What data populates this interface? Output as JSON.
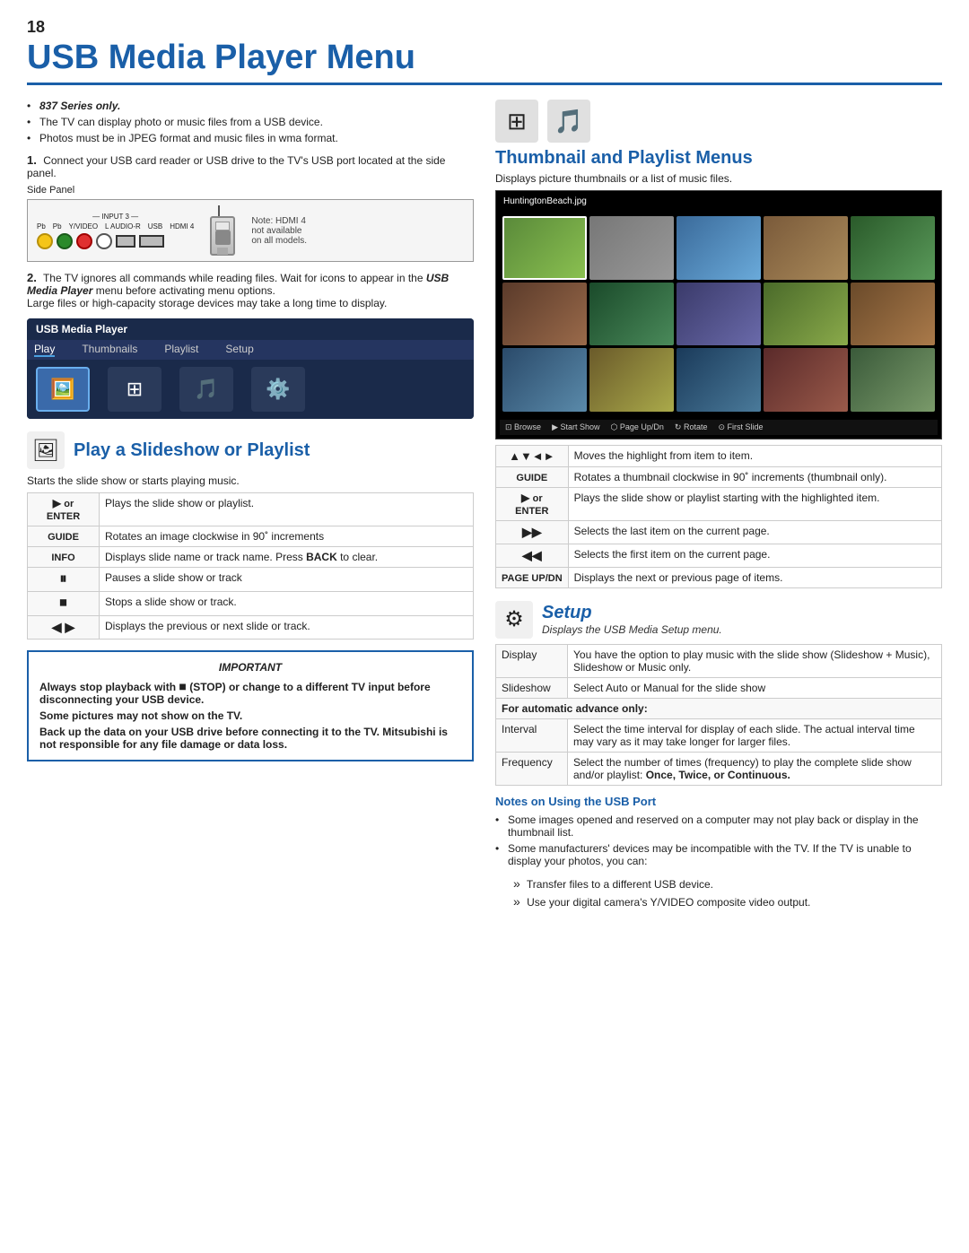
{
  "page": {
    "number": "18",
    "title": "USB Media Player Menu"
  },
  "left_col": {
    "series_note": "837 Series only.",
    "bullet1": "The TV can display photo or music files from a USB device.",
    "bullet2": "Photos must be in JPEG format and music files in wma format.",
    "step1_text": "Connect your USB card reader or USB drive to the TV's USB port located at the side panel.",
    "side_panel_label": "Side Panel",
    "note_hdmi": "Note: HDMI 4",
    "note_hdmi2": "not available",
    "note_hdmi3": "on all models.",
    "step2_text": "The TV ignores all commands while reading files. Wait for icons to appear in the",
    "step2_bold": "USB Media Player",
    "step2_text2": "menu before activating menu options.",
    "step2_text3": "Large files or high-capacity storage devices may take a long time to display.",
    "usb_player": {
      "title": "USB Media Player",
      "tabs": [
        "Play",
        "Thumbnails",
        "Playlist",
        "Setup"
      ]
    }
  },
  "slideshow_section": {
    "title": "Play a Slideshow or Playlist",
    "subtitle": "Starts the slide show or starts playing music.",
    "controls": [
      {
        "key": "▶ or ENTER",
        "desc": "Plays the slide show or playlist."
      },
      {
        "key": "GUIDE",
        "desc": "Rotates an image clockwise in 90˚ increments"
      },
      {
        "key": "INFO",
        "desc": "Displays slide name or track name. Press BACK to clear."
      },
      {
        "key": "⏸",
        "desc": "Pauses a slide show or track"
      },
      {
        "key": "⏹",
        "desc": "Stops a slide show or track."
      },
      {
        "key": "◀ ▶",
        "desc": "Displays the previous or next slide or track."
      }
    ],
    "important_title": "IMPORTANT",
    "important_lines": [
      "Always stop playback with ■ (STOP) or change to a different TV input before disconnecting your USB device.",
      "Some pictures may not show on the TV.",
      "Back up the data on your USB drive before connecting it to the TV. Mitsubishi is not responsible for any file damage or data loss."
    ]
  },
  "thumbnail_section": {
    "title": "Thumbnail and Playlist Menus",
    "subtitle": "Displays picture thumbnails or a list of music files.",
    "filename": "HuntingtonBeach.jpg",
    "bottom_controls": [
      "Browse",
      "Start Show",
      "Page Up/Dn",
      "Rotate",
      "First Slide"
    ],
    "controls": [
      {
        "key": "▲▼◄►",
        "desc": "Moves the highlight from item to item."
      },
      {
        "key": "GUIDE",
        "desc": "Rotates a thumbnail clockwise in 90˚ increments (thumbnail only)."
      },
      {
        "key": "▶ or ENTER",
        "desc": "Plays the slide show or playlist starting with the highlighted item."
      },
      {
        "key": "▶▶",
        "desc": "Selects the last item on the current page."
      },
      {
        "key": "◄◄",
        "desc": "Selects the first item on the current page."
      },
      {
        "key": "PAGE UP/DN",
        "desc": "Displays the next or previous page of items."
      }
    ]
  },
  "setup_section": {
    "title": "Setup",
    "subtitle": "Displays the USB Media Setup menu.",
    "rows": [
      {
        "key": "Display",
        "desc": "You have the option to play music with the slide show (Slideshow + Music), Slideshow or Music only."
      },
      {
        "key": "Slideshow",
        "desc": "Select Auto or Manual for the slide show"
      },
      {
        "key": "for_automatic",
        "desc": "For automatic advance only:"
      },
      {
        "key": "Interval",
        "desc": "Select the time interval for display of each slide. The actual interval time may vary as it may take longer for larger files."
      },
      {
        "key": "Frequency",
        "desc": "Select the number of times (frequency) to play the complete slide show and/or playlist: Once, Twice, or Continuous."
      }
    ]
  },
  "notes_section": {
    "title": "Notes on Using the USB Port",
    "bullets": [
      "Some images opened and reserved on a computer may not play back or display in the thumbnail list.",
      "Some manufacturers' devices may be incompatible with the TV. If the TV is unable to display your photos, you can:",
      "Transfer files to a different USB device.",
      "Use your digital camera's Y/VIDEO composite video output."
    ]
  }
}
